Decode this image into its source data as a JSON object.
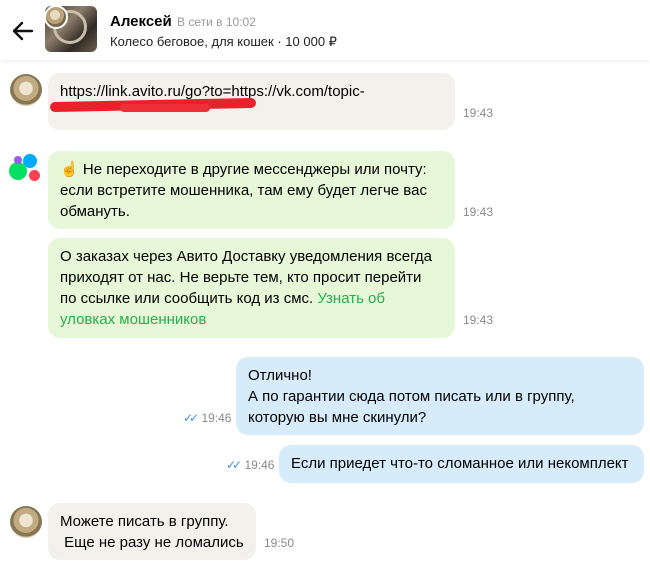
{
  "header": {
    "contact_name": "Алексей",
    "status": "В сети в 10:02",
    "item_title": "Колесо беговое, для кошек",
    "item_sep": " · ",
    "item_price": "10 000 ₽"
  },
  "messages": [
    {
      "text": "https://link.avito.ru/go?to=https://vk.com/topic-",
      "time": "19:43"
    },
    {
      "emoji": "☝",
      "text": " Не переходите в другие мессенджеры или почту: если встретите мошенника, там ему будет легче вас обмануть.",
      "time": "19:43"
    },
    {
      "text": "О заказах через Авито Доставку уведомления всегда приходят от нас. Не верьте тем, кто просит перейти по ссылке или сообщить код из смс. ",
      "link": "Узнать об уловках мошенников",
      "time": "19:43"
    },
    {
      "line1": "Отлично!",
      "line2": "А по гарантии сюда потом писать или в группу, которую вы мне скинули?",
      "time": "19:46",
      "ticks": "✓✓"
    },
    {
      "text": "Если приедет что-то сломанное или некомплект",
      "time": "19:46",
      "ticks": "✓✓"
    },
    {
      "line1": "Можете писать в группу.",
      "line2": " Еще не разу не ломались",
      "time": "19:50"
    }
  ],
  "colors": {
    "incoming": "#f3f1ec",
    "system": "#e6f8d8",
    "outgoing": "#d6ecfb",
    "link": "#2aac4f",
    "read_ticks": "#3b95e8"
  },
  "icons": [
    "back-arrow-icon",
    "avito-logo-icon",
    "double-check-icon"
  ]
}
